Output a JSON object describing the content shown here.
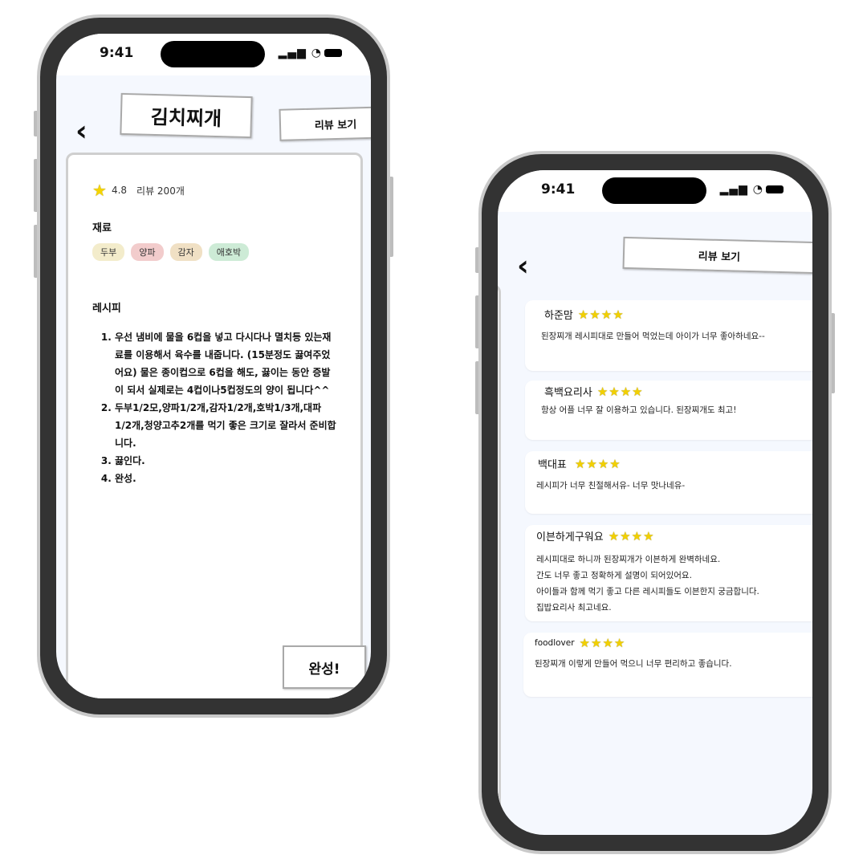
{
  "left_phone": {
    "status": {
      "time": "9:41",
      "icons": "▂▄▆ ◔"
    },
    "back": "‹",
    "title": "김치찌개",
    "review_button": "리뷰 보기",
    "rating": {
      "star": "★",
      "score": "4.8",
      "reviews": "리뷰 200개"
    },
    "ingredients_title": "재료",
    "ingredients": [
      {
        "label": "두부",
        "color": "#f3eccb"
      },
      {
        "label": "양파",
        "color": "#f2cccc"
      },
      {
        "label": "감자",
        "color": "#f0e0c4"
      },
      {
        "label": "애호박",
        "color": "#cdebd6"
      }
    ],
    "recipe_title": "레시피",
    "steps": [
      "우선 냄비에 물을 6컵을 넣고 다시다나 멸치등 있는재료를 이용해서 육수를 내줍니다. (15분정도 끓여주었어요) 물은 종이컵으로 6컵을 해도, 끓이는 동안 증발이 되서 실제로는 4컵이나5컵정도의 양이 됩니다^^",
      "두부1/2모,양파1/2개,감자1/2개,호박1/3개,대파1/2개,청양고추2개를 먹기 좋은 크기로 잘라서 준비합니다.",
      "끓인다.",
      "완성."
    ],
    "done_button": "완성!"
  },
  "right_phone": {
    "status": {
      "time": "9:41",
      "icons": "▂▄▆ ◔"
    },
    "back": "‹",
    "title": "리뷰 보기",
    "reviews": [
      {
        "name": "하준맘",
        "stars": "★★★★",
        "text": "된장찌개 레시피대로 만들어 먹었는데 아이가 너무 좋아하네요--"
      },
      {
        "name": "흑백요리사",
        "stars": "★★★★",
        "text": "항상 어플 너무 잘 이용하고 있습니다. 된장찌개도 최고!"
      },
      {
        "name": "백대표",
        "stars": "★★★★",
        "text": "레시피가 너무 친절해서유- 너무 맛나네유-"
      },
      {
        "name": "이븐하게구워요",
        "stars": "★★★★",
        "lines": [
          "레시피대로 하니까 된장찌개가 이븐하게 완벽하네요.",
          "간도 너무 좋고 정확하게 설명이 되어있어요.",
          "아이들과 함께 먹기 좋고 다른 레시피들도 이븐한지 궁금합니다.",
          "집밥요리사 최고네요."
        ]
      },
      {
        "name": "foodlover",
        "stars": "★★★★",
        "text": "된장찌개 이렇게 만들어 먹으니 너무 편리하고 좋습니다."
      }
    ]
  }
}
